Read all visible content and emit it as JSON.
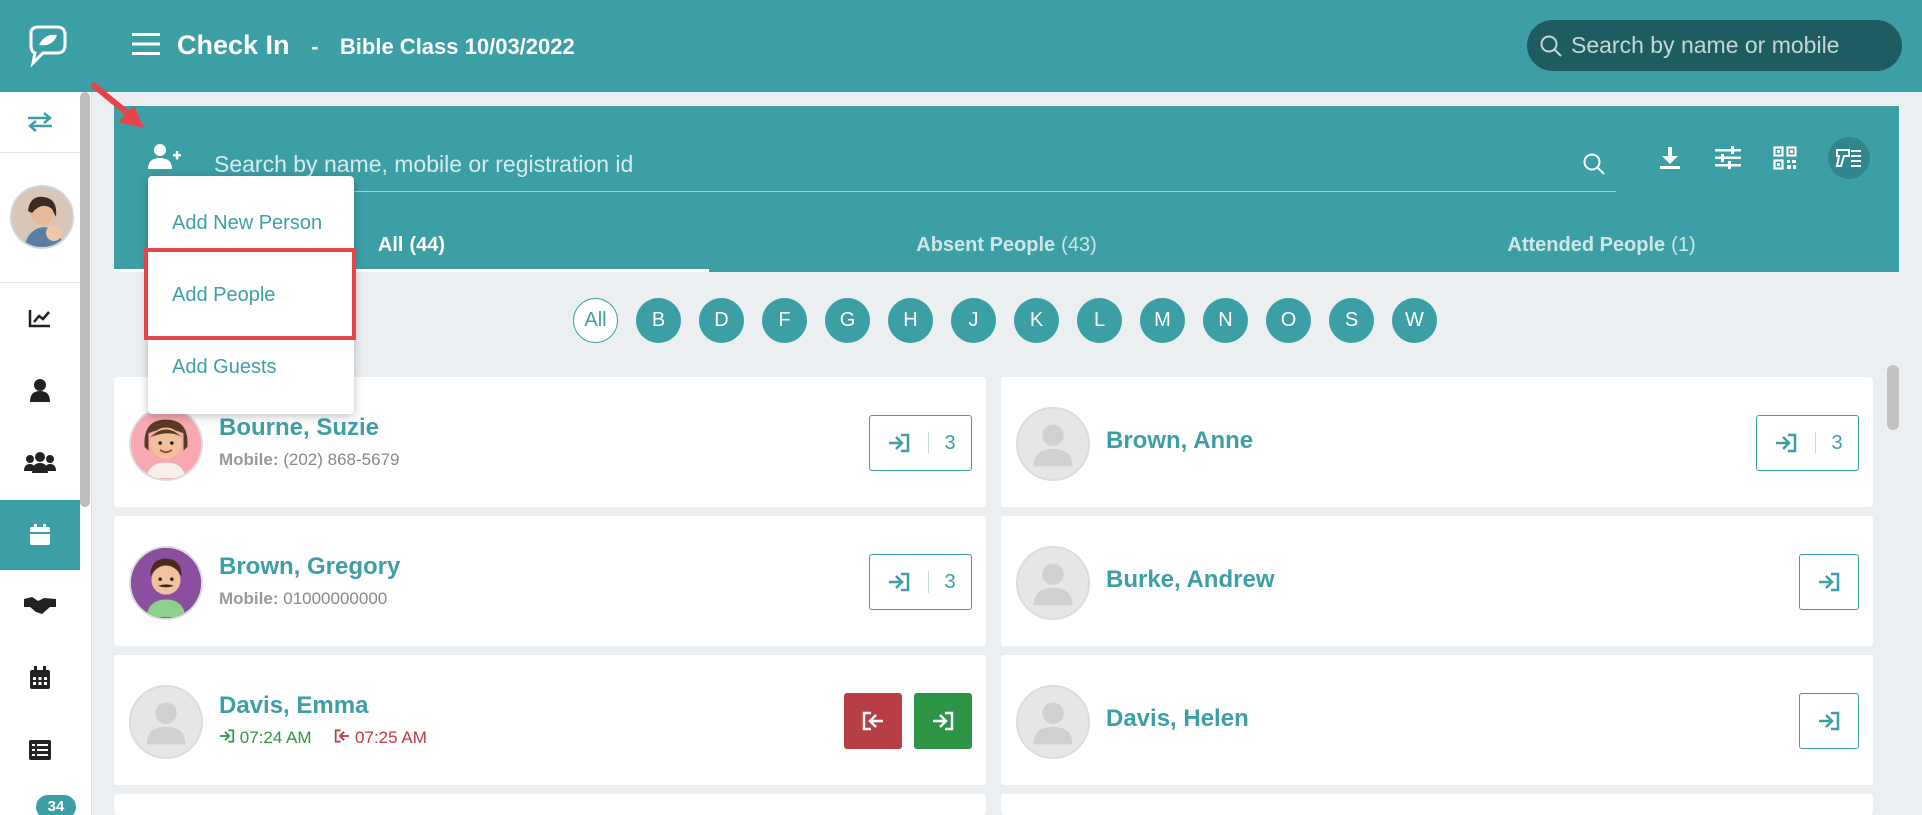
{
  "header": {
    "title": "Check In",
    "separator": "-",
    "subtitle": "Bible Class 10/03/2022",
    "search_placeholder": "Search by name or mobile"
  },
  "sidebar": {
    "badge": "34",
    "items": [
      "switch-icon",
      "chart-icon",
      "person-icon",
      "group-icon",
      "calendar-icon",
      "handshake-icon",
      "schedule-icon",
      "list-icon"
    ],
    "active": "calendar-icon"
  },
  "panel": {
    "search_placeholder": "Search by name, mobile or registration id",
    "tabs": [
      {
        "label": "All",
        "count": "(44)"
      },
      {
        "label": "Absent People",
        "count": "(43)"
      },
      {
        "label": "Attended People",
        "count": "(1)"
      }
    ]
  },
  "dropdown": {
    "items": [
      "Add New Person",
      "Add People",
      "Add Guests"
    ]
  },
  "letters": [
    "All",
    "B",
    "D",
    "F",
    "G",
    "H",
    "J",
    "K",
    "L",
    "M",
    "N",
    "O",
    "S",
    "W"
  ],
  "people": [
    {
      "name": "Bourne, Suzie",
      "mobile_label": "Mobile:",
      "mobile": "(202) 868-5679",
      "count": "3"
    },
    {
      "name": "Brown, Anne",
      "count": "3"
    },
    {
      "name": "Brown, Gregory",
      "mobile_label": "Mobile:",
      "mobile": "01000000000",
      "count": "3"
    },
    {
      "name": "Burke, Andrew"
    },
    {
      "name": "Davis, Emma",
      "check_in": "07:24 AM",
      "check_out": "07:25 AM"
    },
    {
      "name": "Davis, Helen"
    }
  ],
  "colors": {
    "primary": "#3d9fa6",
    "dark": "#1f5c61",
    "in": "#2e9547",
    "out": "#b83e45",
    "highlight": "#e54548"
  }
}
